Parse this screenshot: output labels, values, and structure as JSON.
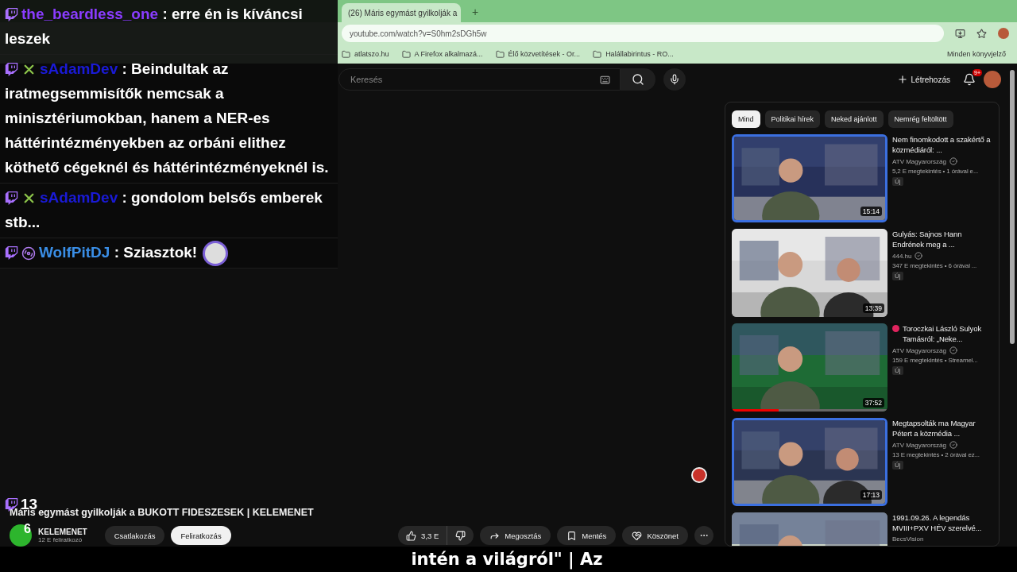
{
  "browser": {
    "tabs": [
      {
        "title": "(26) Máris egymást gyilkolják a",
        "selected": true
      }
    ],
    "new_tab": "+",
    "url": "youtube.com/watch?v=S0hm2sDGh5w",
    "bookmarks": [
      "atlatszo.hu",
      "A Firefox alkalmazá...",
      "Élő közvetítések - Or...",
      "Halállabirintus - RO..."
    ],
    "all_bookmarks": "Minden könyvjelző"
  },
  "header": {
    "search": {
      "placeholder": "Keresés"
    },
    "create": "Létrehozás",
    "notifications": "9+"
  },
  "video": {
    "title": "Máris egymást gyilkolják a BUKOTT FIDESZESEK | KELEMENET",
    "channel": "KELEMENET",
    "subscribers": "12 E feliratkozó",
    "join": "Csatlakozás",
    "subscribe": "Feliratkozás",
    "likes": "3,3 E",
    "share": "Megosztás",
    "save": "Mentés",
    "thanks": "Köszönet"
  },
  "chips": [
    {
      "label": "Mind",
      "selected": true
    },
    {
      "label": "Politikai hírek",
      "selected": false
    },
    {
      "label": "Neked ajánlott",
      "selected": false
    },
    {
      "label": "Nemrég feltöltött",
      "selected": false
    }
  ],
  "recommendations": [
    {
      "title": "Nem finomkodott a szakértő a közmédiáról: ...",
      "channel": "ATV Magyarország",
      "verified": true,
      "meta": "5,2 E megtekintés • 1 órával e...",
      "badge": "Új",
      "duration": "15:14",
      "outlined": true,
      "live": false
    },
    {
      "title": "Gulyás: Sajnos Hann Endrének meg a ...",
      "channel": "444.hu",
      "verified": true,
      "meta": "347 E megtekintés • 6 órával ...",
      "badge": "Új",
      "duration": "13:39",
      "outlined": false,
      "live": false
    },
    {
      "title": "Toroczkai László Sulyok Tamásról: „Neke...",
      "channel": "ATV Magyarország",
      "verified": true,
      "meta": "159 E megtekintés • Streamel...",
      "badge": "Új",
      "duration": "37:52",
      "outlined": false,
      "live": true,
      "level": 0.3
    },
    {
      "title": "Megtapsolták ma Magyar Pétert a közmédia ...",
      "channel": "ATV Magyarország",
      "verified": true,
      "meta": "13 E megtekintés • 2 órával ez...",
      "badge": "Új",
      "duration": "17:13",
      "outlined": true,
      "live": false
    },
    {
      "title": "1991.09.26. A legendás MVIII+PXV HÉV szerelvé...",
      "channel": "BecsVision",
      "verified": false
    }
  ],
  "chat": [
    {
      "user": "the_beardless_one",
      "color": "#8a3cff",
      "badges": [
        {
          "kind": "twitch"
        }
      ],
      "text": ": erre én is kíváncsi leszek",
      "emote": false
    },
    {
      "user": "sAdamDev",
      "color": "#1a1ad6",
      "badges": [
        {
          "kind": "twitch"
        },
        {
          "kind": "x"
        }
      ],
      "text": ": Beindultak az iratmegsemmisítők nemcsak a minisztériumokban, hanem a NER-es háttérintézményekben az orbáni elithez köthető cégeknél és háttérintézményeknél is.",
      "emote": false
    },
    {
      "user": "sAdamDev",
      "color": "#1a1ad6",
      "badges": [
        {
          "kind": "twitch"
        },
        {
          "kind": "x"
        }
      ],
      "text": ": gondolom belsős emberek stb...",
      "emote": false
    },
    {
      "user": "WolfPitDJ",
      "color": "#3a8ee6",
      "badges": [
        {
          "kind": "twitch"
        },
        {
          "kind": "disc"
        }
      ],
      "text": ": Sziasztok!",
      "emote": true
    }
  ],
  "stream_overlay": {
    "twitch_viewers": "13",
    "youtube_viewers": "6"
  },
  "subtitle": "intén a világról\" | Az"
}
